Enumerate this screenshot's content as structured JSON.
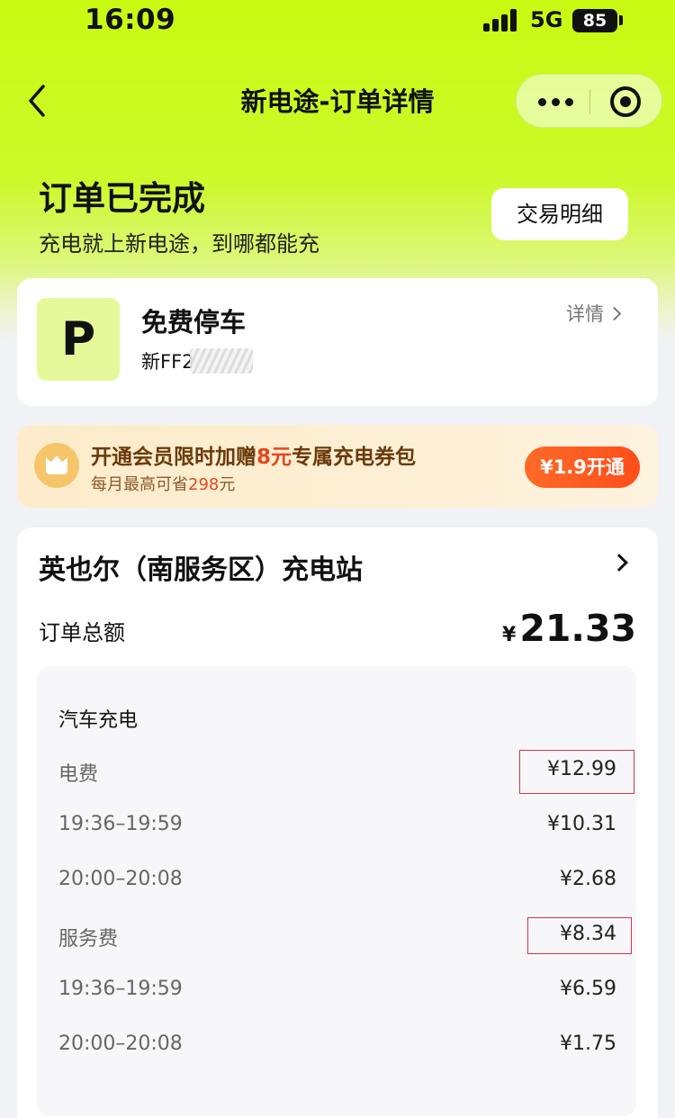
{
  "status_bar": {
    "time": "16:09",
    "network": "5G",
    "battery": "85"
  },
  "nav": {
    "title": "新电途-订单详情"
  },
  "order": {
    "status": "订单已完成",
    "slogan": "充电就上新电途，到哪都能充",
    "detail_button": "交易明细"
  },
  "parking": {
    "logo_letter": "P",
    "title": "免费停车",
    "plate_visible": "新FF2",
    "link": "详情"
  },
  "promo": {
    "text_before": "开通会员限时加赠",
    "text_highlight": "8元",
    "text_after": "专属充电券包",
    "sub_before": "每月最高可省",
    "sub_highlight": "298",
    "sub_after": "元",
    "button": "¥1.9开通"
  },
  "station": {
    "name": "英也尔（南服务区）充电站",
    "total_label": "订单总额",
    "total_currency": "¥",
    "total_amount": "21.33",
    "breakdown_title": "汽车充电",
    "rows": [
      {
        "label": "电费",
        "amount": "¥12.99"
      },
      {
        "label": "19:36–19:59",
        "amount": "¥10.31"
      },
      {
        "label": "20:00–20:08",
        "amount": "¥2.68"
      },
      {
        "label": "服务费",
        "amount": "¥8.34"
      },
      {
        "label": "19:36–19:59",
        "amount": "¥6.59"
      },
      {
        "label": "20:00–20:08",
        "amount": "¥1.75"
      }
    ]
  },
  "colors": {
    "accent_green": "#c8fa12",
    "promo_orange": "#ff5a1f",
    "highlight_red": "#d9334b"
  }
}
